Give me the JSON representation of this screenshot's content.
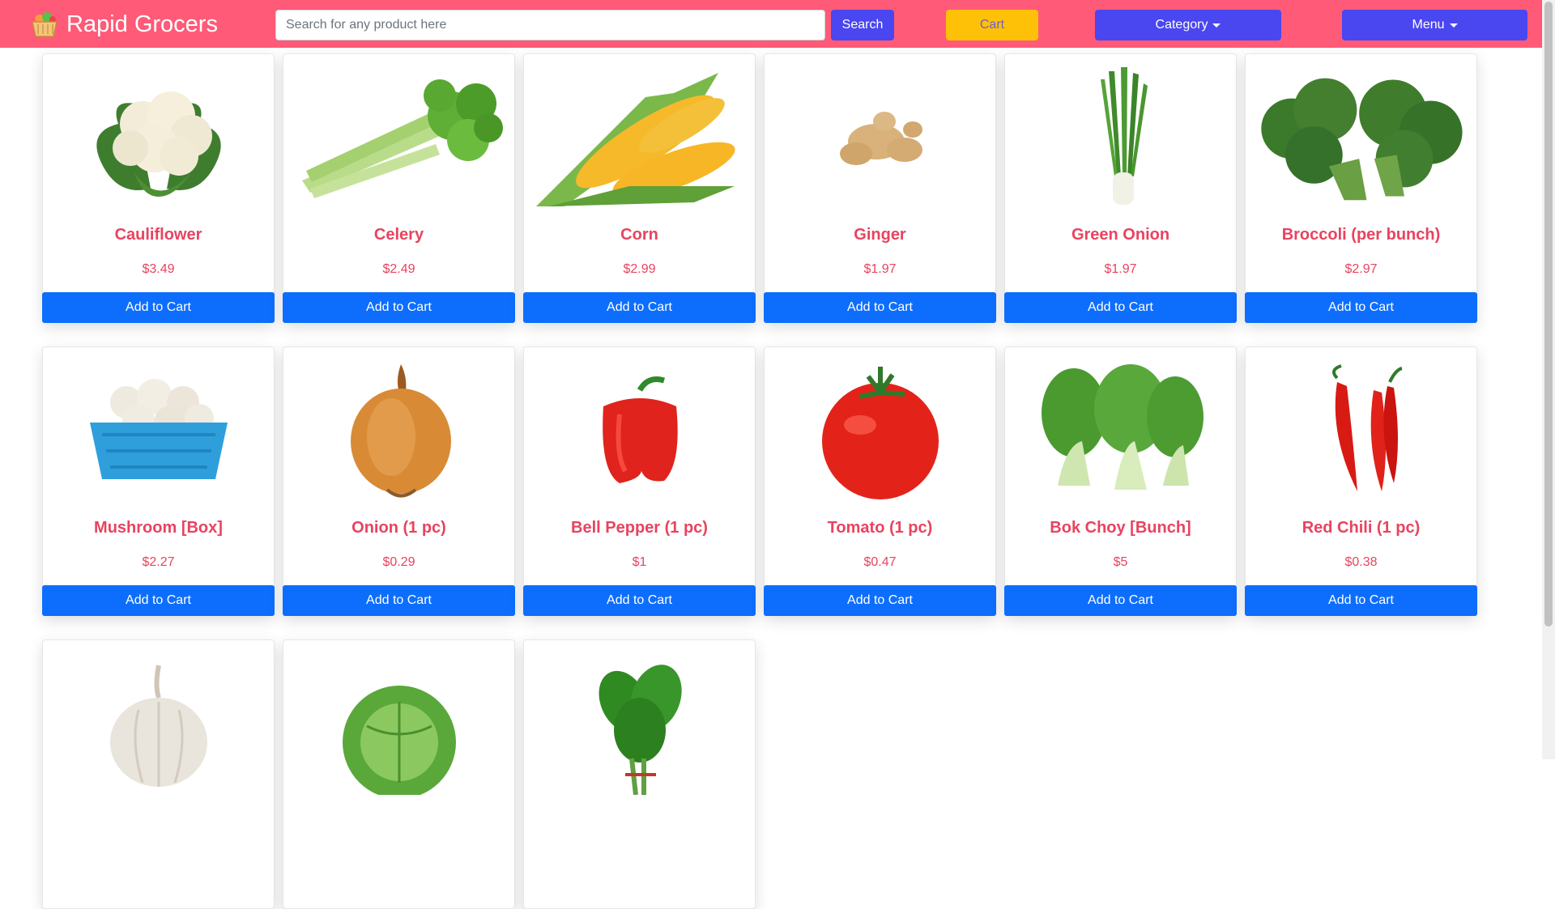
{
  "header": {
    "brand": "Rapid Grocers",
    "search_placeholder": "Search for any product here",
    "search_label": "Search",
    "cart_label": "Cart",
    "category_label": "Category",
    "menu_label": "Menu"
  },
  "colors": {
    "navbar": "#ff5a78",
    "primary_button": "#4a46f0",
    "cart_button": "#ffc107",
    "add_to_cart": "#0d6efd",
    "product_text": "#e8435f"
  },
  "products": [
    {
      "name": "Cauliflower",
      "price": "$3.49",
      "button": "Add to Cart",
      "icon": "cauliflower-image"
    },
    {
      "name": "Celery",
      "price": "$2.49",
      "button": "Add to Cart",
      "icon": "celery-image"
    },
    {
      "name": "Corn",
      "price": "$2.99",
      "button": "Add to Cart",
      "icon": "corn-image"
    },
    {
      "name": "Ginger",
      "price": "$1.97",
      "button": "Add to Cart",
      "icon": "ginger-image"
    },
    {
      "name": "Green Onion",
      "price": "$1.97",
      "button": "Add to Cart",
      "icon": "green-onion-image"
    },
    {
      "name": "Broccoli (per bunch)",
      "price": "$2.97",
      "button": "Add to Cart",
      "icon": "broccoli-image"
    },
    {
      "name": "Mushroom [Box]",
      "price": "$2.27",
      "button": "Add to Cart",
      "icon": "mushroom-image"
    },
    {
      "name": "Onion (1 pc)",
      "price": "$0.29",
      "button": "Add to Cart",
      "icon": "onion-image"
    },
    {
      "name": "Bell Pepper (1 pc)",
      "price": "$1",
      "button": "Add to Cart",
      "icon": "bell-pepper-image"
    },
    {
      "name": "Tomato (1 pc)",
      "price": "$0.47",
      "button": "Add to Cart",
      "icon": "tomato-image"
    },
    {
      "name": "Bok Choy [Bunch]",
      "price": "$5",
      "button": "Add to Cart",
      "icon": "bok-choy-image"
    },
    {
      "name": "Red Chili (1 pc)",
      "price": "$0.38",
      "button": "Add to Cart",
      "icon": "red-chili-image"
    },
    {
      "name": "",
      "price": "",
      "button": "",
      "icon": "garlic-image"
    },
    {
      "name": "",
      "price": "",
      "button": "",
      "icon": "cabbage-image"
    },
    {
      "name": "",
      "price": "",
      "button": "",
      "icon": "spinach-image"
    }
  ]
}
